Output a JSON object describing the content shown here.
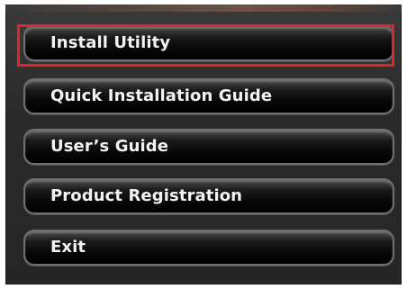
{
  "menu": {
    "items": [
      {
        "id": "install-utility",
        "label": "Install Utility",
        "highlighted": true
      },
      {
        "id": "quick-installation-guide",
        "label": "Quick Installation Guide",
        "highlighted": false
      },
      {
        "id": "users-guide",
        "label": "User’s Guide",
        "highlighted": false
      },
      {
        "id": "product-registration",
        "label": "Product Registration",
        "highlighted": false
      },
      {
        "id": "exit",
        "label": "Exit",
        "highlighted": false
      }
    ]
  },
  "colors": {
    "highlight": "#e4242b",
    "button_text": "#f2f2f2",
    "panel_background": "#2a2a2a"
  }
}
